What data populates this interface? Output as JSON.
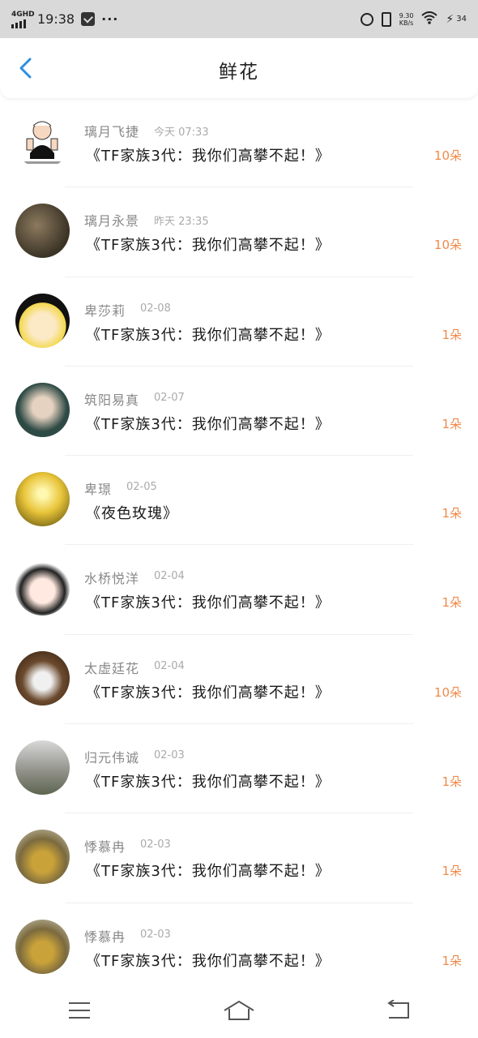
{
  "status_bar": {
    "network": "4GHD",
    "time": "19:38",
    "more": "···",
    "speed_value": "9.30",
    "speed_unit": "KB/s",
    "battery": "34"
  },
  "header": {
    "title": "鲜花"
  },
  "colors": {
    "accent_blue": "#2b8fe0",
    "count_orange": "#ef8a4a"
  },
  "rows": [
    {
      "name": "璃月飞捷",
      "time": "今天 07:33",
      "gift": "《TF家族3代：我你们高攀不起！》",
      "count": "10朵",
      "avatar": "cartoon-avatar"
    },
    {
      "name": "璃月永景",
      "time": "昨天 23:35",
      "gift": "《TF家族3代：我你们高攀不起！》",
      "count": "10朵",
      "avatar": "warrior-avatar"
    },
    {
      "name": "卑莎莉",
      "time": "02-08",
      "gift": "《TF家族3代：我你们高攀不起！》",
      "count": "1朵",
      "avatar": "maruko-avatar"
    },
    {
      "name": "筑阳易真",
      "time": "02-07",
      "gift": "《TF家族3代：我你们高攀不起！》",
      "count": "1朵",
      "avatar": "woman-avatar"
    },
    {
      "name": "卑璟",
      "time": "02-05",
      "gift": "《夜色玫瑰》",
      "count": "1朵",
      "avatar": "sunset-avatar"
    },
    {
      "name": "水桥悦洋",
      "time": "02-04",
      "gift": "《TF家族3代：我你们高攀不起！》",
      "count": "1朵",
      "avatar": "anime-avatar"
    },
    {
      "name": "太虚廷花",
      "time": "02-04",
      "gift": "《TF家族3代：我你们高攀不起！》",
      "count": "10朵",
      "avatar": "puppy-avatar"
    },
    {
      "name": "归元伟诚",
      "time": "02-03",
      "gift": "《TF家族3代：我你们高攀不起！》",
      "count": "1朵",
      "avatar": "room-avatar"
    },
    {
      "name": "悸慕冉",
      "time": "02-03",
      "gift": "《TF家族3代：我你们高攀不起！》",
      "count": "1朵",
      "avatar": "child-avatar"
    },
    {
      "name": "悸慕冉",
      "time": "02-03",
      "gift": "《TF家族3代：我你们高攀不起！》",
      "count": "1朵",
      "avatar": "child-avatar"
    }
  ],
  "navbar": {
    "menu_icon": "menu-icon",
    "home_icon": "home-icon",
    "back_icon": "return-icon"
  }
}
